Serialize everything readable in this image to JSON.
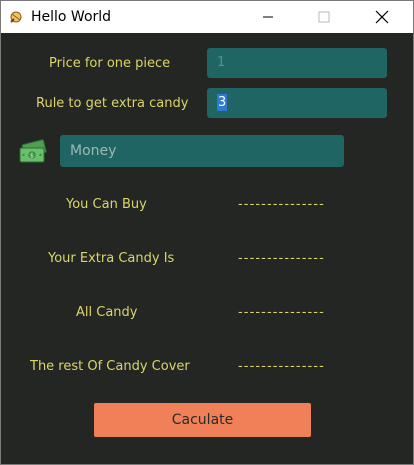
{
  "window": {
    "title": "Hello World"
  },
  "form": {
    "price_label": "Price for one piece",
    "price_value": "1",
    "rule_label": "Rule to get extra candy",
    "rule_value": "3",
    "money_placeholder": "Money"
  },
  "results": {
    "you_can_buy_label": "You Can Buy",
    "you_can_buy_value": "---------------",
    "extra_candy_label": "Your Extra Candy Is",
    "extra_candy_value": "---------------",
    "all_candy_label": "All Candy",
    "all_candy_value": "---------------",
    "rest_cover_label": "The rest Of Candy Cover",
    "rest_cover_value": "---------------"
  },
  "actions": {
    "calculate_label": "Caculate"
  },
  "colors": {
    "background": "#232623",
    "label": "#dcd56a",
    "field": "#1e6563",
    "button": "#f08057"
  },
  "icons": {
    "app": "candy-icon",
    "money": "money-bills-icon"
  }
}
